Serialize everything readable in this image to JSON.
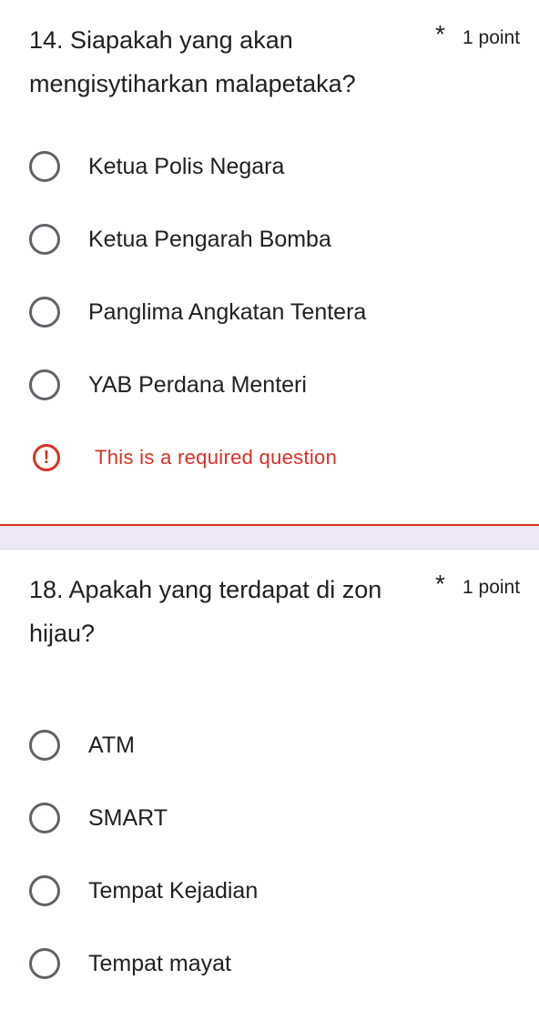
{
  "questions": [
    {
      "title": "14. Siapakah yang akan mengisytiharkan malapetaka?",
      "required_marker": "*",
      "points": "1 point",
      "options": [
        "Ketua Polis Negara",
        "Ketua Pengarah Bomba",
        "Panglima Angkatan Tentera",
        "YAB Perdana Menteri"
      ],
      "error": {
        "icon": "exclamation-icon",
        "text": "This is a required question"
      }
    },
    {
      "title": "18. Apakah yang terdapat di zon hijau?",
      "required_marker": "*",
      "points": "1 point",
      "options": [
        "ATM",
        "SMART",
        "Tempat Kejadian",
        "Tempat mayat"
      ]
    }
  ],
  "colors": {
    "page_background": "#ede7f6",
    "card_background": "#ffffff",
    "error": "#d93025",
    "radio_border": "#5f6368",
    "text": "#202124"
  }
}
